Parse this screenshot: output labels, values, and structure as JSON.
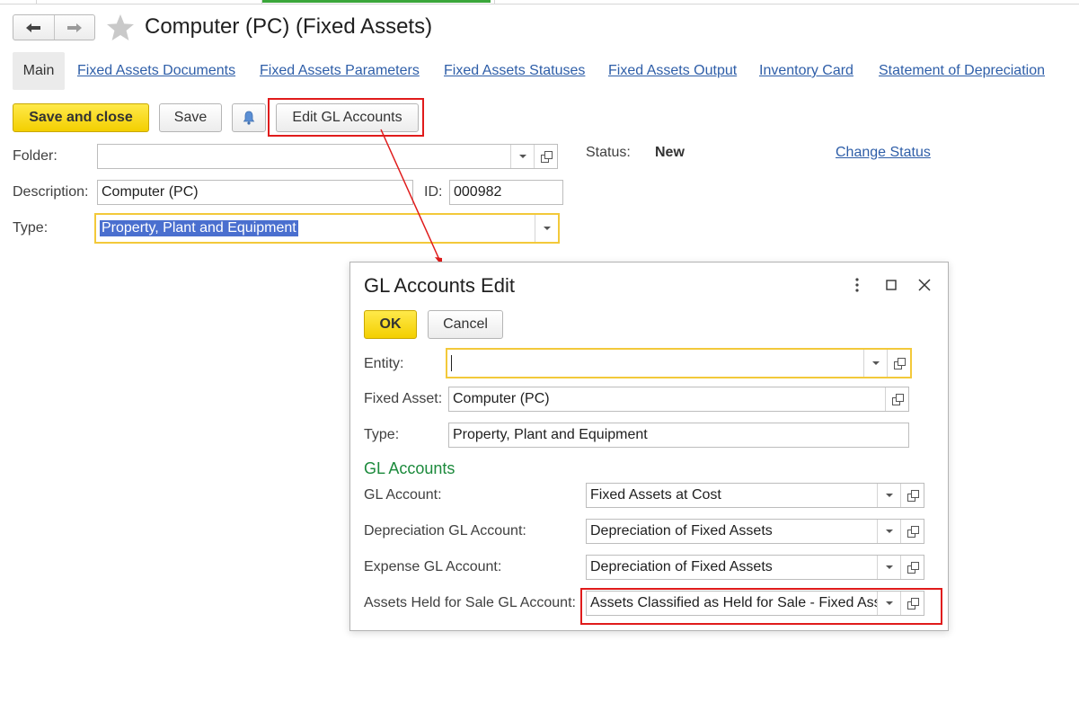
{
  "window": {
    "title": "Computer (PC) (Fixed Assets)"
  },
  "icons": {
    "back": "arrow-left-icon",
    "forward": "arrow-right-icon",
    "favorite": "star-icon",
    "bell": "bell-icon",
    "more": "more-vertical-icon",
    "maximize": "maximize-icon",
    "close": "close-icon"
  },
  "tabs": [
    {
      "label": "Main"
    },
    {
      "label": "Fixed Assets Documents"
    },
    {
      "label": "Fixed Assets Parameters"
    },
    {
      "label": "Fixed Assets Statuses"
    },
    {
      "label": "Fixed Assets Output"
    },
    {
      "label": "Inventory Card"
    },
    {
      "label": "Statement of Depreciation"
    }
  ],
  "toolbar": {
    "save_close_label": "Save and close",
    "save_label": "Save",
    "edit_gl_label": "Edit GL Accounts"
  },
  "form": {
    "folder_label": "Folder:",
    "folder_value": "",
    "description_label": "Description:",
    "description_value": "Computer (PC)",
    "id_label": "ID:",
    "id_value": "000982",
    "type_label": "Type:",
    "type_value": "Property, Plant and Equipment",
    "status_label": "Status:",
    "status_value": "New",
    "change_status_label": "Change Status"
  },
  "dialog": {
    "title": "GL Accounts Edit",
    "ok_label": "OK",
    "cancel_label": "Cancel",
    "entity_label": "Entity:",
    "entity_value": "",
    "fixed_asset_label": "Fixed Asset:",
    "fixed_asset_value": "Computer (PC)",
    "type_label": "Type:",
    "type_value": "Property, Plant and Equipment",
    "section_title": "GL Accounts",
    "gl_account_label": "GL Account:",
    "gl_account_value": "Fixed Assets at Cost",
    "depreciation_label": "Depreciation GL Account:",
    "depreciation_value": "Depreciation of Fixed Assets",
    "expense_label": "Expense GL Account:",
    "expense_value": "Depreciation of Fixed Assets",
    "held_for_sale_label": "Assets Held for Sale GL Account:",
    "held_for_sale_value": "Assets Classified as Held for Sale - Fixed Assets"
  },
  "colors": {
    "accent_yellow": "#f3cf00",
    "link_blue": "#2e5ea8",
    "section_green": "#1c8a3c",
    "highlight_red": "#e01b1b",
    "selection_blue": "#4a6fcf"
  }
}
